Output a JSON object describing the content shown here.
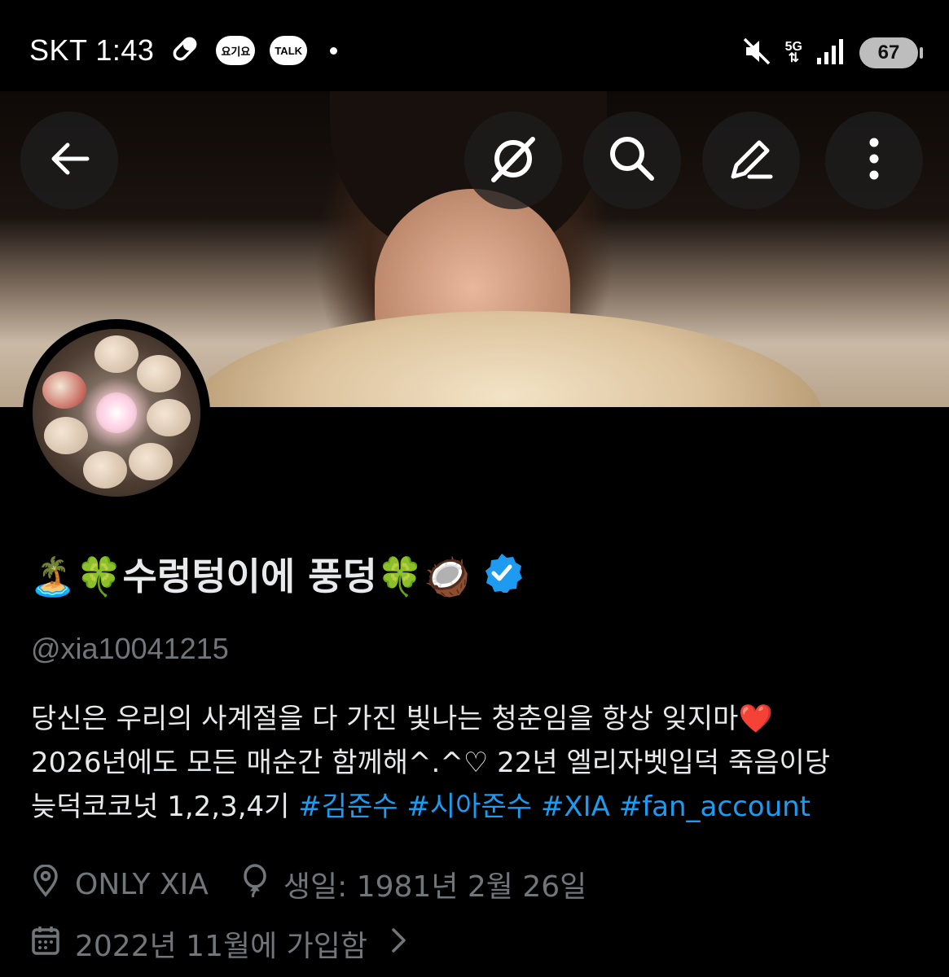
{
  "status_bar": {
    "carrier_time": "SKT 1:43",
    "app_badges": [
      "요기요",
      "TALK"
    ],
    "network": "5G",
    "battery": "67"
  },
  "header": {
    "icons": [
      "back-arrow-icon",
      "grok-icon",
      "search-icon",
      "edit-icon",
      "more-icon"
    ]
  },
  "profile": {
    "display_name": "🏝️🍀수렁텅이에 풍덩🍀🥥",
    "verified": true,
    "handle": "@xia10041215",
    "bio_line1": "당신은 우리의 사계절을 다 가진 빛나는 청춘임을 항상 잊지마❤️",
    "bio_line2": "2026년에도 모든 매순간 함께해^.^♡ 22년 엘리자벳입덕 죽음이당",
    "bio_line3_text": "늦덕코코넛 1,2,3,4기",
    "hashtags": [
      "#김준수",
      "#시아준수",
      "#XIA",
      "#fan_account"
    ],
    "location": "ONLY XIA",
    "birthday": "생일: 1981년 2월 26일",
    "joined": "2022년 11월에 가입함"
  },
  "colors": {
    "background": "#000000",
    "text": "#e7e9ea",
    "muted": "#71767b",
    "link": "#1d9bf0",
    "verified": "#1d9bf0"
  }
}
